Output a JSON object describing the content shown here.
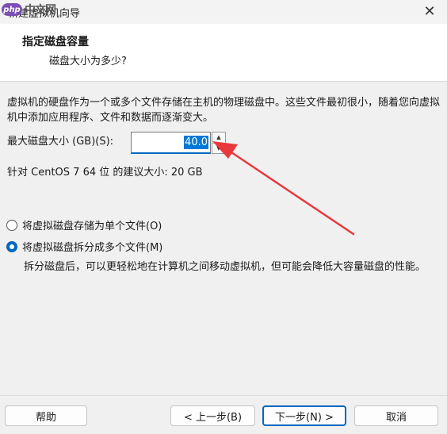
{
  "watermark": {
    "badge": "php",
    "text": "中文网"
  },
  "window": {
    "title": "新建虚拟机向导",
    "close_glyph": "✕"
  },
  "header": {
    "title": "指定磁盘容量",
    "subtitle": "磁盘大小为多少?"
  },
  "main": {
    "description": "虚拟机的硬盘作为一个或多个文件存储在主机的物理磁盘中。这些文件最初很小，随着您向虚拟机中添加应用程序、文件和数据而逐渐变大。",
    "size_label": "最大磁盘大小 (GB)(S):",
    "size_value": "40.0",
    "spin_up": "▲",
    "spin_down": "▼",
    "recommend": "针对 CentOS 7 64 位 的建议大小: 20 GB",
    "radio_single": "将虚拟磁盘存储为单个文件(O)",
    "radio_split": "将虚拟磁盘拆分成多个文件(M)",
    "split_description": "拆分磁盘后，可以更轻松地在计算机之间移动虚拟机，但可能会降低大容量磁盘的性能。",
    "selected_option": "split"
  },
  "footer": {
    "help": "帮助",
    "back": "< 上一步(B)",
    "next": "下一步(N) >",
    "cancel": "取消"
  },
  "colors": {
    "accent": "#0067c0",
    "annotation_arrow": "#e8383d"
  }
}
